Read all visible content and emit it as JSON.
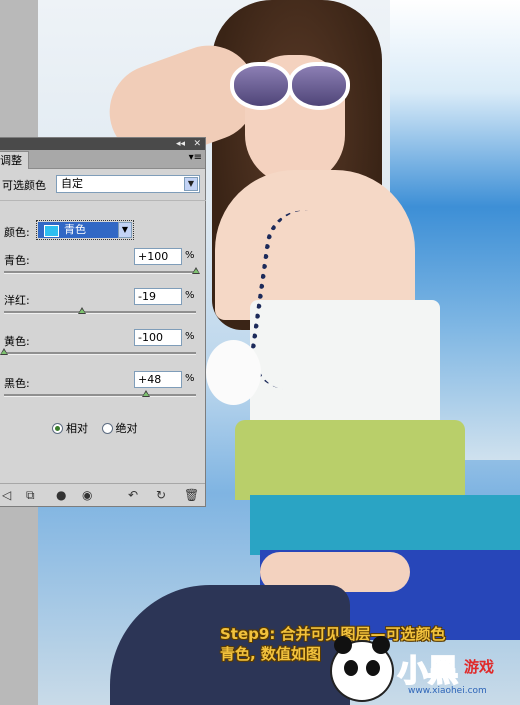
{
  "panel": {
    "top_collapse": "◂◂",
    "top_close": "✕",
    "tab_label": "调整",
    "menu_icon": "menu-icon",
    "preset_label": "可选颜色",
    "preset_value": "自定",
    "colors_label": "颜色:",
    "colors_value": "青色",
    "swatch_color": "#2fbff0",
    "sliders": [
      {
        "label": "青色:",
        "value": "+100",
        "unit": "%",
        "level": 100
      },
      {
        "label": "洋红:",
        "value": "-19",
        "unit": "%",
        "level": -19
      },
      {
        "label": "黄色:",
        "value": "-100",
        "unit": "%",
        "level": -100
      },
      {
        "label": "黑色:",
        "value": "+48",
        "unit": "%",
        "level": 48
      }
    ],
    "method_relative": "相对",
    "method_absolute": "绝对",
    "method_selected": "relative"
  },
  "caption": {
    "line1": "Step9: 合并可见图层—可选颜色",
    "line2": "青色, 数值如图"
  },
  "logo": {
    "main": "小黑",
    "sub": "游戏",
    "url": "www.xiaohei.com"
  }
}
